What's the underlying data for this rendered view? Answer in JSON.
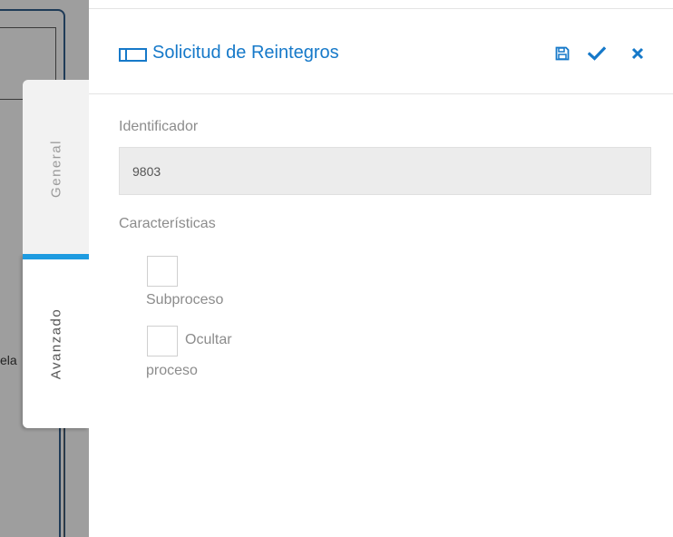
{
  "canvas": {
    "partial_text": "ela"
  },
  "tabs": [
    {
      "label": "General",
      "active": false
    },
    {
      "label": "Avanzado",
      "active": true
    }
  ],
  "header": {
    "title": "Solicitud de Reintegros",
    "icons": {
      "title": "panel-icon",
      "save": "floppy-disk-icon",
      "accept": "checkmark-icon",
      "close": "x-icon"
    }
  },
  "form": {
    "identificador": {
      "label": "Identificador",
      "value": "9803"
    },
    "caracteristicas": {
      "label": "Características",
      "options": [
        {
          "label": "Subproceso",
          "checked": false
        },
        {
          "label_line1": "Ocultar",
          "label_line2": "proceso",
          "checked": false
        }
      ]
    }
  },
  "colors": {
    "accent": "#1679c9",
    "tab_active": "#1e9be0",
    "label": "#8c8c8c",
    "input_bg": "#ececec",
    "canvas_bg": "#9e9e9e"
  }
}
